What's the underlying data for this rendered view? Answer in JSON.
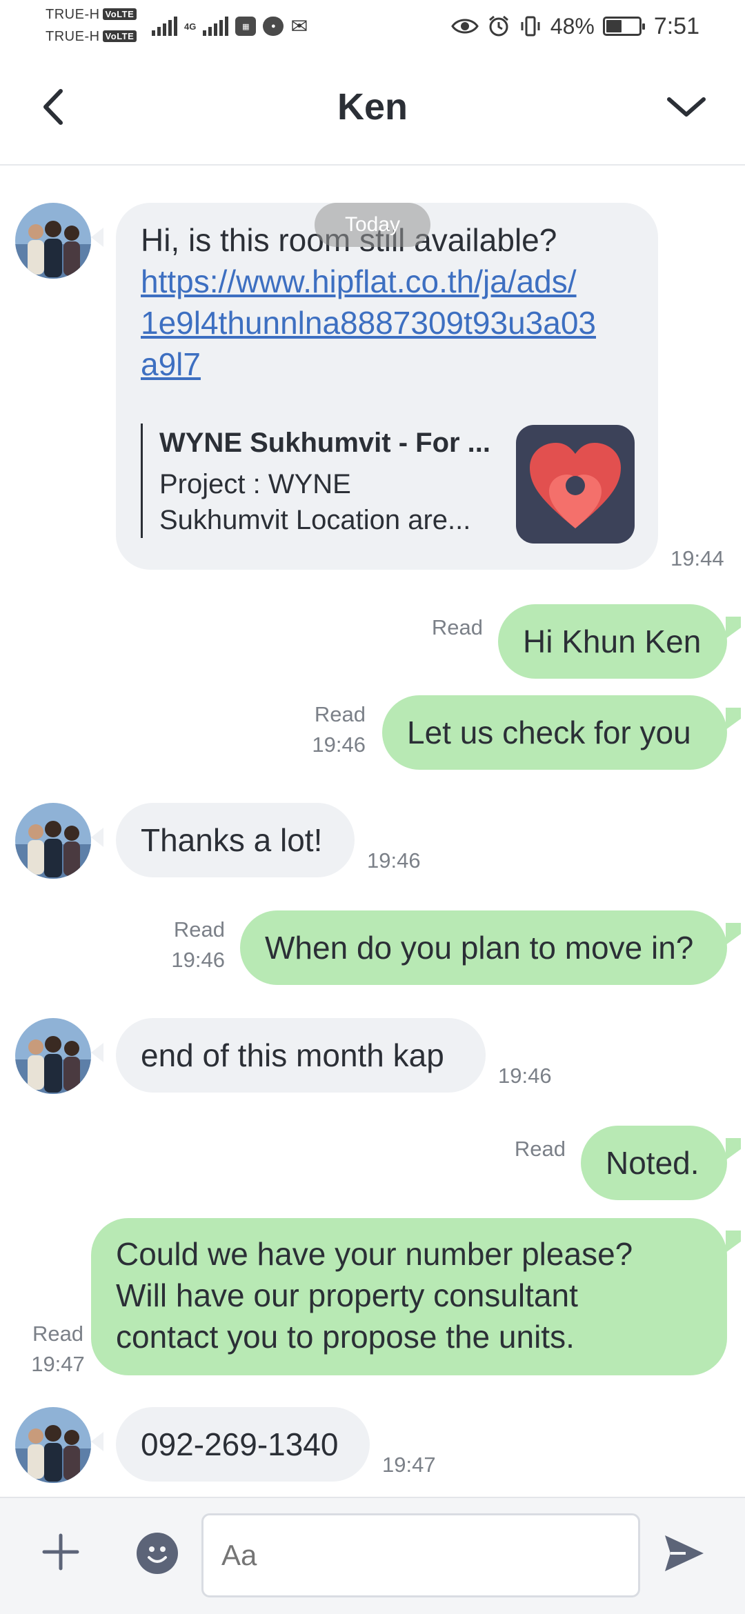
{
  "status_bar": {
    "carrier1": "TRUE-H",
    "carrier2": "TRUE-H",
    "volte": "VoLTE",
    "network": "4G",
    "battery_percent": "48%",
    "battery_level": 0.48,
    "time": "7:51"
  },
  "header": {
    "title": "Ken"
  },
  "chat": {
    "date_chip": "Today",
    "messages": [
      {
        "direction": "incoming",
        "text": "Hi, is this room still available?",
        "link": "https://www.hipflat.co.th/ja/ads/1e9l4thunnlna8887309t93u3a03a9l7",
        "link_lines": [
          "https://www.hipflat.co.th/ja/ads/",
          "1e9l4thunnlna8887309t93u3a03",
          "a9l7"
        ],
        "preview_title": "WYNE Sukhumvit - For ...",
        "preview_desc_lines": [
          "Project : WYNE",
          "Sukhumvit Location are..."
        ],
        "time": "19:44"
      },
      {
        "direction": "outgoing",
        "text": "Hi Khun Ken",
        "read": "Read",
        "time": ""
      },
      {
        "direction": "outgoing",
        "text": "Let us check for you",
        "read": "Read",
        "time": "19:46"
      },
      {
        "direction": "incoming",
        "text": "Thanks a lot!",
        "time": "19:46"
      },
      {
        "direction": "outgoing",
        "text": "When do you plan to move in?",
        "read": "Read",
        "time": "19:46"
      },
      {
        "direction": "incoming",
        "text": "end of this month kap",
        "time": "19:46"
      },
      {
        "direction": "outgoing",
        "text": "Noted.",
        "read": "Read",
        "time": ""
      },
      {
        "direction": "outgoing",
        "text_lines": [
          "Could we have your number please?",
          "Will have our property consultant",
          "contact you to propose the units."
        ],
        "read": "Read",
        "time": "19:47"
      },
      {
        "direction": "incoming",
        "text": "092-269-1340",
        "time": "19:47"
      }
    ]
  },
  "input": {
    "placeholder": "Aa"
  },
  "colors": {
    "incoming_bubble": "#eff1f4",
    "outgoing_bubble": "#b8e9b4",
    "link": "#3d6fc1",
    "icon": "#5c6478"
  },
  "icons": [
    "back-chevron-icon",
    "dropdown-chevron-icon",
    "plus-icon",
    "emoji-icon",
    "send-icon",
    "eye-icon",
    "alarm-icon",
    "vibrate-icon",
    "battery-icon"
  ]
}
